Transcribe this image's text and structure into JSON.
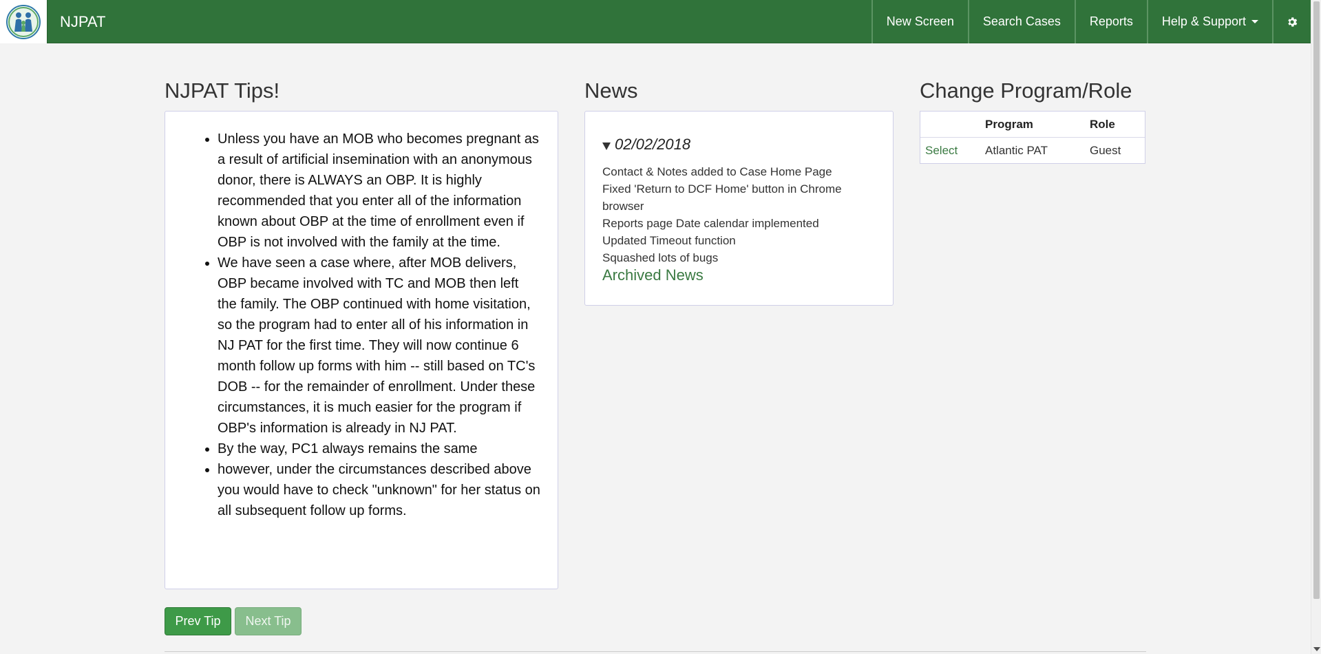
{
  "navbar": {
    "brand": "NJPAT",
    "items": [
      {
        "label": "New Screen"
      },
      {
        "label": "Search Cases"
      },
      {
        "label": "Reports"
      },
      {
        "label": "Help & Support"
      }
    ],
    "settings_icon": "gear-icon",
    "color": "#30733a"
  },
  "tips": {
    "heading": "NJPAT Tips!",
    "items": [
      "Unless you have an MOB who becomes pregnant as a result of artificial insemination with an anonymous donor, there is ALWAYS an OBP. It is highly recommended that you enter all of the information known about OBP at the time of enrollment even if OBP is not involved with the family at the time.",
      "We have seen a case where, after MOB delivers, OBP became involved with TC and MOB then left the family. The OBP continued with home visitation, so the program had to enter all of his information in NJ PAT for the first time. They will now continue 6 month follow up forms with him -- still based on TC's DOB -- for the remainder of enrollment. Under these circumstances, it is much easier for the program if OBP's information is already in NJ PAT.",
      "By the way, PC1 always remains the same",
      "however, under the circumstances described above you would have to check \"unknown\" for her status on all subsequent follow up forms."
    ],
    "prev_label": "Prev Tip",
    "next_label": "Next Tip"
  },
  "news": {
    "heading": "News",
    "date": "02/02/2018",
    "items": [
      "Contact & Notes added to Case Home Page",
      "Fixed 'Return to DCF Home' button in Chrome browser",
      "Reports page Date calendar implemented",
      "Updated Timeout function",
      "Squashed lots of bugs"
    ],
    "archived_label": "Archived News"
  },
  "role": {
    "heading": "Change Program/Role",
    "columns": [
      "",
      "Program",
      "Role"
    ],
    "rows": [
      {
        "action": "Select",
        "program": "Atlantic PAT",
        "role": "Guest"
      }
    ]
  }
}
